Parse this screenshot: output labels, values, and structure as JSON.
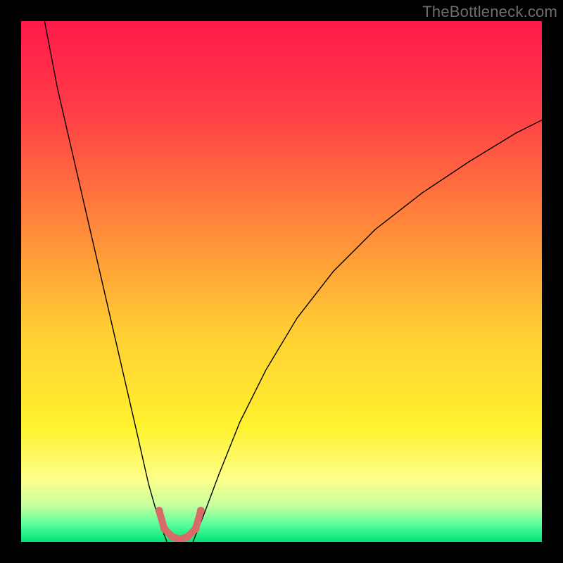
{
  "watermark": "TheBottleneck.com",
  "chart_data": {
    "type": "line",
    "title": "",
    "xlabel": "",
    "ylabel": "",
    "xlim": [
      0,
      100
    ],
    "ylim": [
      0,
      100
    ],
    "background_gradient": {
      "stops": [
        {
          "offset": 0,
          "color": "#ff1a4b"
        },
        {
          "offset": 0.18,
          "color": "#ff3f46"
        },
        {
          "offset": 0.4,
          "color": "#ff8a3a"
        },
        {
          "offset": 0.6,
          "color": "#ffcf33"
        },
        {
          "offset": 0.78,
          "color": "#fff22e"
        },
        {
          "offset": 0.88,
          "color": "#fdff8a"
        },
        {
          "offset": 0.93,
          "color": "#c8ff9f"
        },
        {
          "offset": 0.965,
          "color": "#5cff9b"
        },
        {
          "offset": 1.0,
          "color": "#00e577"
        }
      ]
    },
    "series": [
      {
        "name": "left-arm",
        "x": [
          4.5,
          7,
          10,
          13,
          16,
          19,
          22,
          24.5,
          26.5,
          28
        ],
        "y": [
          100,
          87,
          74,
          61,
          48,
          35,
          22,
          11,
          4,
          0
        ],
        "color": "#000000",
        "width": 1.4
      },
      {
        "name": "right-arm",
        "x": [
          33,
          35,
          38,
          42,
          47,
          53,
          60,
          68,
          77,
          86,
          95,
          100
        ],
        "y": [
          0,
          5,
          13,
          23,
          33,
          43,
          52,
          60,
          67,
          73,
          78.5,
          81
        ],
        "color": "#000000",
        "width": 1.4
      },
      {
        "name": "trough-marker",
        "x": [
          26.5,
          27.5,
          29,
          30.5,
          32,
          33.5,
          34.5
        ],
        "y": [
          6,
          2.5,
          1,
          0.5,
          1,
          2.5,
          6
        ],
        "color": "#d96a6a",
        "width": 10,
        "dots": true
      }
    ]
  }
}
